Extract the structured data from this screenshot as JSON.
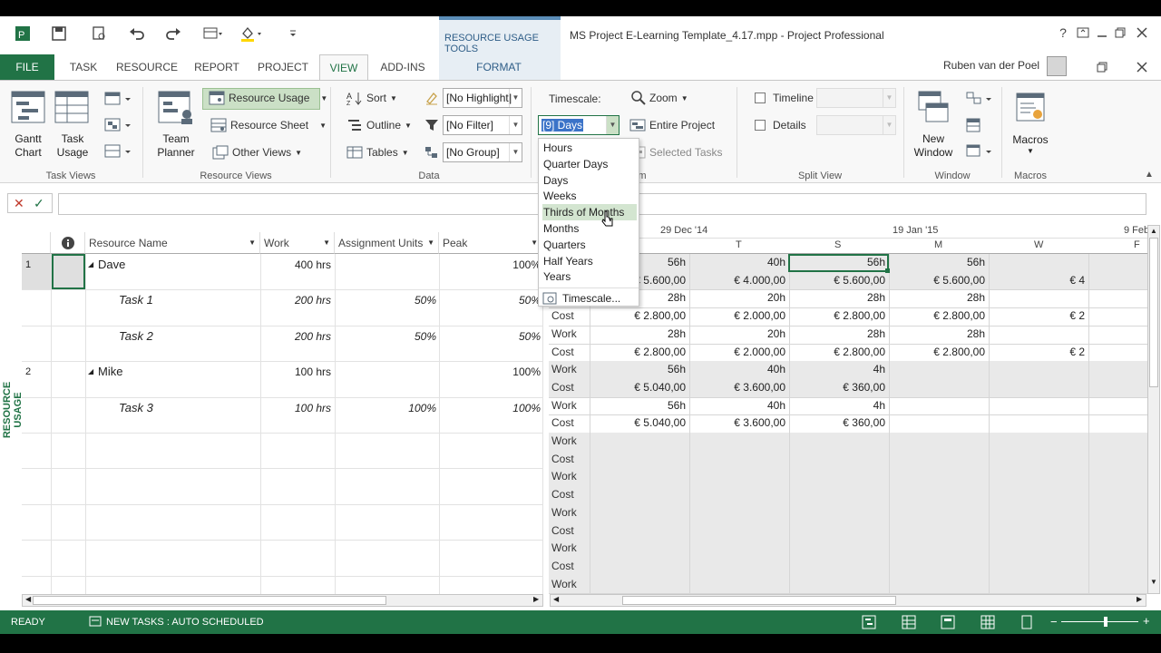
{
  "title_bar": {
    "context_tab": "RESOURCE USAGE TOOLS",
    "title": "MS Project E-Learning Template_4.17.mpp - Project Professional",
    "user": "Ruben van der Poel"
  },
  "tabs": [
    "FILE",
    "TASK",
    "RESOURCE",
    "REPORT",
    "PROJECT",
    "VIEW",
    "ADD-INS",
    "FORMAT"
  ],
  "ribbon": {
    "task_views": {
      "label": "Task Views",
      "gantt": "Gantt\nChart",
      "task_usage": "Task\nUsage"
    },
    "resource_views": {
      "label": "Resource Views",
      "team_planner": "Team\nPlanner",
      "resource_usage": "Resource Usage",
      "resource_sheet": "Resource Sheet",
      "other_views": "Other Views"
    },
    "data": {
      "label": "Data",
      "sort": "Sort",
      "outline": "Outline",
      "tables": "Tables",
      "highlight": "[No Highlight]",
      "filter": "[No Filter]",
      "group": "[No Group]"
    },
    "zoom": {
      "label": "m",
      "timescale_label": "Timescale:",
      "timescale_value": "[9] Days",
      "zoom": "Zoom",
      "entire_project": "Entire Project",
      "selected_tasks": "Selected Tasks"
    },
    "split_view": {
      "label": "Split View",
      "timeline": "Timeline",
      "details": "Details"
    },
    "window": {
      "label": "Window",
      "new_window": "New\nWindow"
    },
    "macros": {
      "label": "Macros",
      "macros": "Macros"
    }
  },
  "timescale_dropdown": {
    "items": [
      "Hours",
      "Quarter Days",
      "Days",
      "Weeks",
      "Thirds of Months",
      "Months",
      "Quarters",
      "Half Years",
      "Years"
    ],
    "highlighted": "Thirds of Months",
    "footer": "Timescale..."
  },
  "sheet": {
    "columns": [
      "Resource Name",
      "Work",
      "Assignment Units",
      "Peak"
    ],
    "rows": [
      {
        "id": "1",
        "name": "Dave",
        "work": "400 hrs",
        "units": "",
        "peak": "100%",
        "level": 0
      },
      {
        "id": "",
        "name": "Task 1",
        "work": "200 hrs",
        "units": "50%",
        "peak": "50%",
        "level": 1
      },
      {
        "id": "",
        "name": "Task 2",
        "work": "200 hrs",
        "units": "50%",
        "peak": "50%",
        "level": 1
      },
      {
        "id": "2",
        "name": "Mike",
        "work": "100 hrs",
        "units": "",
        "peak": "100%",
        "level": 0
      },
      {
        "id": "",
        "name": "Task 3",
        "work": "100 hrs",
        "units": "100%",
        "peak": "100%",
        "level": 1
      }
    ],
    "side_label": "RESOURCE USAGE"
  },
  "timescale": {
    "major": [
      "29 Dec '14",
      "19 Jan '15",
      "9 Feb"
    ],
    "minor": [
      "T",
      "S",
      "M",
      "W",
      "F"
    ],
    "rows": [
      {
        "label": "",
        "vals": [
          "56h",
          "40h",
          "56h",
          "56h",
          ""
        ]
      },
      {
        "label": "",
        "vals": [
          "€ 5.600,00",
          "€ 4.000,00",
          "€ 5.600,00",
          "€ 5.600,00",
          "€ 4"
        ]
      },
      {
        "label": "",
        "vals": [
          "28h",
          "20h",
          "28h",
          "28h",
          ""
        ]
      },
      {
        "label": "Cost",
        "vals": [
          "€ 2.800,00",
          "€ 2.000,00",
          "€ 2.800,00",
          "€ 2.800,00",
          "€ 2"
        ]
      },
      {
        "label": "Work",
        "vals": [
          "28h",
          "20h",
          "28h",
          "28h",
          ""
        ]
      },
      {
        "label": "Cost",
        "vals": [
          "€ 2.800,00",
          "€ 2.000,00",
          "€ 2.800,00",
          "€ 2.800,00",
          "€ 2"
        ]
      },
      {
        "label": "Work",
        "vals": [
          "56h",
          "40h",
          "4h",
          "",
          ""
        ]
      },
      {
        "label": "Cost",
        "vals": [
          "€ 5.040,00",
          "€ 3.600,00",
          "€ 360,00",
          "",
          ""
        ]
      },
      {
        "label": "Work",
        "vals": [
          "56h",
          "40h",
          "4h",
          "",
          ""
        ]
      },
      {
        "label": "Cost",
        "vals": [
          "€ 5.040,00",
          "€ 3.600,00",
          "€ 360,00",
          "",
          ""
        ]
      },
      {
        "label": "Work",
        "vals": [
          "",
          "",
          "",
          "",
          ""
        ]
      },
      {
        "label": "Cost",
        "vals": [
          "",
          "",
          "",
          "",
          ""
        ]
      },
      {
        "label": "Work",
        "vals": [
          "",
          "",
          "",
          "",
          ""
        ]
      },
      {
        "label": "Cost",
        "vals": [
          "",
          "",
          "",
          "",
          ""
        ]
      },
      {
        "label": "Work",
        "vals": [
          "",
          "",
          "",
          "",
          ""
        ]
      },
      {
        "label": "Cost",
        "vals": [
          "",
          "",
          "",
          "",
          ""
        ]
      },
      {
        "label": "Work",
        "vals": [
          "",
          "",
          "",
          "",
          ""
        ]
      },
      {
        "label": "Cost",
        "vals": [
          "",
          "",
          "",
          "",
          ""
        ]
      },
      {
        "label": "Work",
        "vals": [
          "",
          "",
          "",
          "",
          ""
        ]
      }
    ]
  },
  "status_bar": {
    "ready": "READY",
    "new_tasks": "NEW TASKS : AUTO SCHEDULED"
  },
  "colors": {
    "accent": "#217346",
    "context": "#5b8db8",
    "gray_row": "#e9e9e9"
  }
}
